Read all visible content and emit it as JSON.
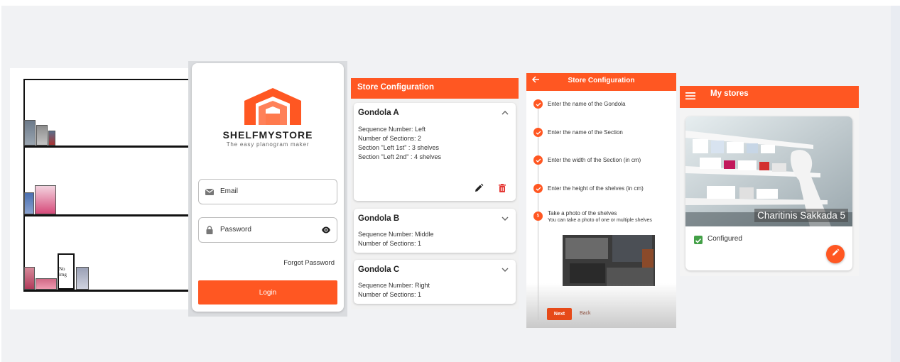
{
  "colors": {
    "accent": "#ff5722",
    "stage_bg": "#f1f2f4",
    "configured_green": "#43a047"
  },
  "planogram": {
    "no_image_label": "No img"
  },
  "login": {
    "brand": "SHELFMYSTORE",
    "tagline": "The easy planogram maker",
    "email_label": "Email",
    "password_label": "Password",
    "forgot_label": "Forgot Password",
    "login_label": "Login",
    "icons": [
      "mail-icon",
      "lock-icon",
      "eye-icon"
    ]
  },
  "gondolas": {
    "title": "Store Configuration",
    "items": [
      {
        "name": "Gondola A",
        "expanded": true,
        "lines": [
          "Sequence Number: Left",
          "Number of Sections: 2",
          "Section \"Left 1st\" : 3 shelves",
          "Section \"Left 2nd\" : 4 shelves"
        ]
      },
      {
        "name": "Gondola B",
        "expanded": false,
        "lines": [
          "Sequence Number: Middle",
          "Number of Sections: 1"
        ]
      },
      {
        "name": "Gondola C",
        "expanded": false,
        "lines": [
          "Sequence Number: Right",
          "Number of Sections: 1"
        ]
      }
    ]
  },
  "stepper": {
    "title": "Store Configuration",
    "steps": [
      {
        "text": "Enter the name of the Gondola",
        "done": true
      },
      {
        "text": "Enter the name of the Section",
        "done": true
      },
      {
        "text": "Enter the width of the Section (in cm)",
        "done": true
      },
      {
        "text": "Enter the height of the shelves (in cm)",
        "done": true
      },
      {
        "text": "Take a photo of the shelves",
        "done": false,
        "number": "5",
        "subtext": "You can take a photo of one or multiple shelves"
      }
    ],
    "next_label": "Next",
    "back_label": "Back"
  },
  "stores": {
    "title": "My stores",
    "store_name": "Charitinis Sakkada 5",
    "status_label": "Configured"
  }
}
